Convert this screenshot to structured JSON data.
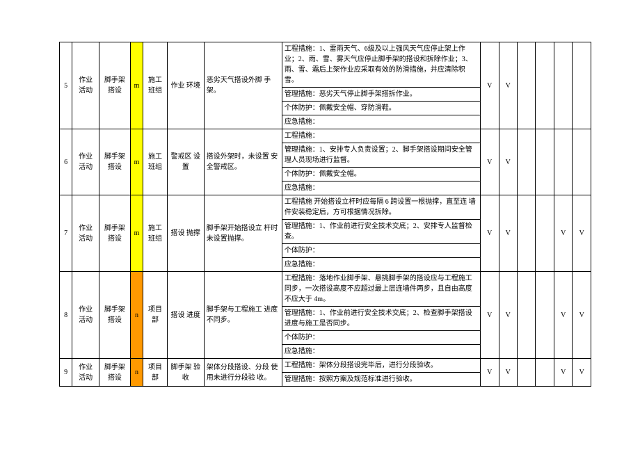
{
  "rows": [
    {
      "num": "5",
      "activity": "作业 活动",
      "sub": "脚手架 搭设",
      "code": "m",
      "code_class": "yellow",
      "group": "施工班组",
      "desc": "作业 环境",
      "detail": "恶劣天气搭设外脚 手架。",
      "measures": [
        "工程措施：1、雷雨天气、6级及以上强风天气应停止架上作业；2、雨、雪、雾天气应停止脚手架的搭设和拆除作业；3、雨、雪、霜后上架作业应采取有效的防滑措施，并应清除积雪。",
        "管理措施：恶劣天气停止脚手架搭拆作业。",
        "个体防护：佩戴安全帽、穿防滑鞋。",
        "应急措施："
      ],
      "checks": [
        "V",
        "V",
        "",
        "",
        "",
        ""
      ]
    },
    {
      "num": "6",
      "activity": "作业 活动",
      "sub": "脚手架 搭设",
      "code": "m",
      "code_class": "yellow",
      "group": "施工班组",
      "desc": "警戒区 设置",
      "detail": "搭设外架时，未设置 安全警戒区。",
      "measures": [
        "工程措施：",
        "管理措施：1、安排专人负责设置；2、脚手架搭设期间安全管理人员现场进行监督。",
        "个体防护：佩戴安全帽。",
        "应急措施："
      ],
      "checks": [
        "V",
        "V",
        "",
        "",
        "",
        ""
      ]
    },
    {
      "num": "7",
      "activity": "作业 活动",
      "sub": "脚手架 搭设",
      "code": "m",
      "code_class": "yellow",
      "group": "施工班组",
      "desc": "搭设 抛撑",
      "detail": "脚手架开始搭设立 杆时未设置抛撑。",
      "measures": [
        "工程措施  开始搭设立杆时应每隔 6 跨设置一根抛撑，直至连 墙件安装稳定后，方可根据情况拆除。",
        "管理措施：1、作业前进行安全技术交底；2、安排专人监督检 查。",
        "个体防护：",
        "应急措施："
      ],
      "checks": [
        "V",
        "V",
        "",
        "",
        "V",
        "V"
      ]
    },
    {
      "num": "8",
      "activity": "作业 活动",
      "sub": "脚手架 搭设",
      "code": "n",
      "code_class": "orange",
      "group": "项目 部",
      "desc": "搭设 进度",
      "detail": "脚手架与工程施工 进度不同步。",
      "measures": [
        "工程措施：落地作业脚手架、悬挑脚手架的搭设应与工程施工 同步，一次搭设高度不应超过最上层连墙件两步，且自由高度 不应大于 4m。",
        "管理措施：1、作业前进行安全技术交底；2、检查脚手架搭设 进度与施工是否同步。",
        "个体防护：",
        "应急措施："
      ],
      "checks": [
        "V",
        "V",
        "",
        "",
        "V",
        "V"
      ]
    },
    {
      "num": "9",
      "activity": "作业 活动",
      "sub": "脚手架 搭设",
      "code": "n",
      "code_class": "orange",
      "group": "项目 部",
      "desc": "脚手架 验收",
      "detail": "架体分段搭设、分段 使用未进行分段验 收。",
      "measures": [
        "工程措施：架体分段搭设完毕后，进行分段验收。",
        "管理措施：按照方案及规范标准进行验收。"
      ],
      "checks": [
        "V",
        "V",
        "",
        "",
        "V",
        "V"
      ]
    }
  ]
}
